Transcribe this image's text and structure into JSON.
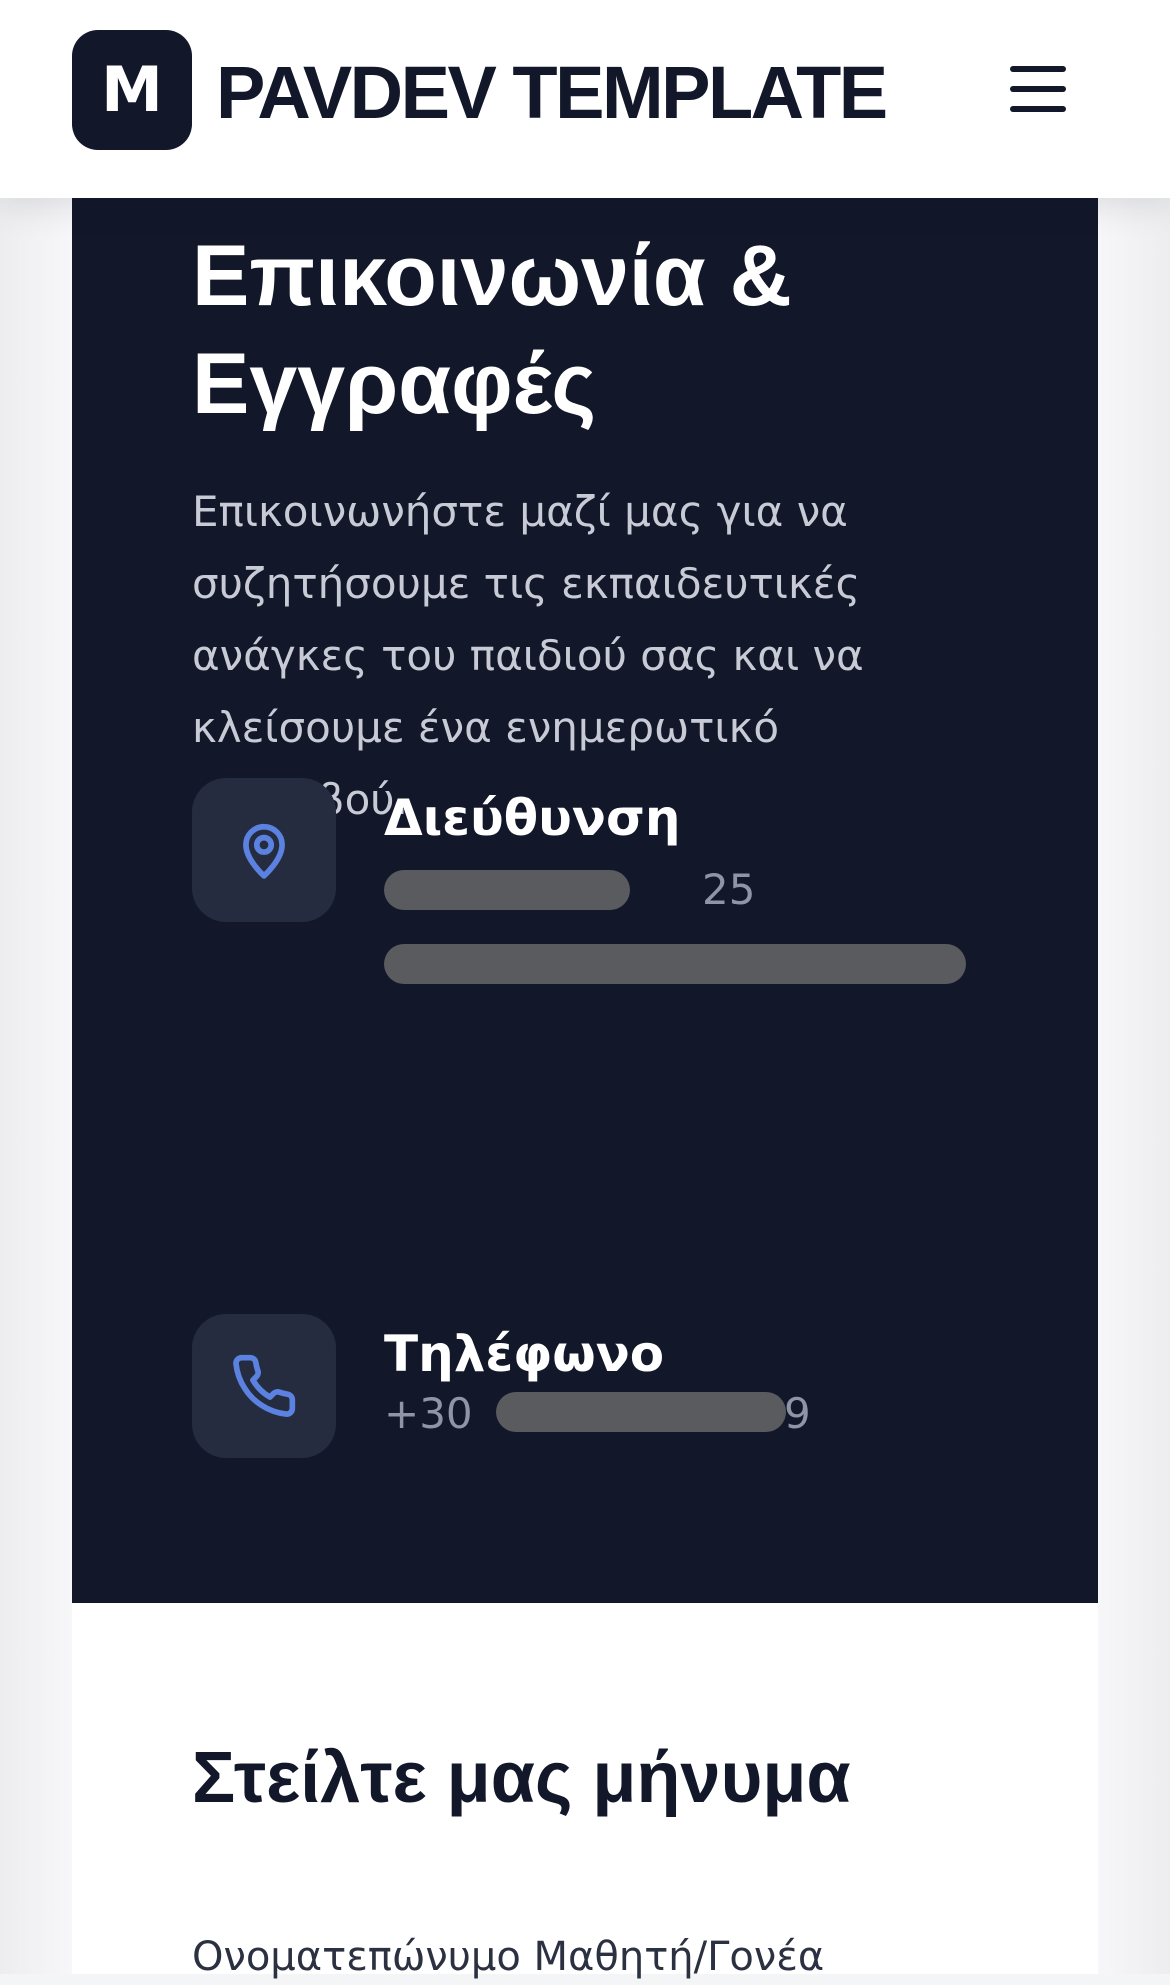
{
  "header": {
    "logo_letter": "M",
    "brand_name": "PAVDEV TEMPLATE",
    "menu_icon": "hamburger-menu-icon"
  },
  "contact": {
    "title": "Επικοινωνία & Εγγραφές",
    "description": "Επικοινωνήστε μαζί μας για να συζητήσουμε τις εκπαιδευτικές ανάγκες του παιδιού σας και να κλείσουμε ένα ενημερωτικό ραντεβού.",
    "address": {
      "icon": "map-pin-icon",
      "heading": "Διεύθυνση",
      "line1_visible": "25"
    },
    "phone": {
      "icon": "phone-icon",
      "heading": "Τηλέφωνο",
      "number_prefix": "+30",
      "number_suffix": "9"
    }
  },
  "form": {
    "title": "Στείλτε μας μήνυμα",
    "name_label": "Ονοματεπώνυμο Μαθητή/Γονέα"
  },
  "colors": {
    "navy": "#121729",
    "icon_accent": "#5b82e0",
    "icon_box": "#262c3f",
    "muted_text": "#8f95a7"
  }
}
